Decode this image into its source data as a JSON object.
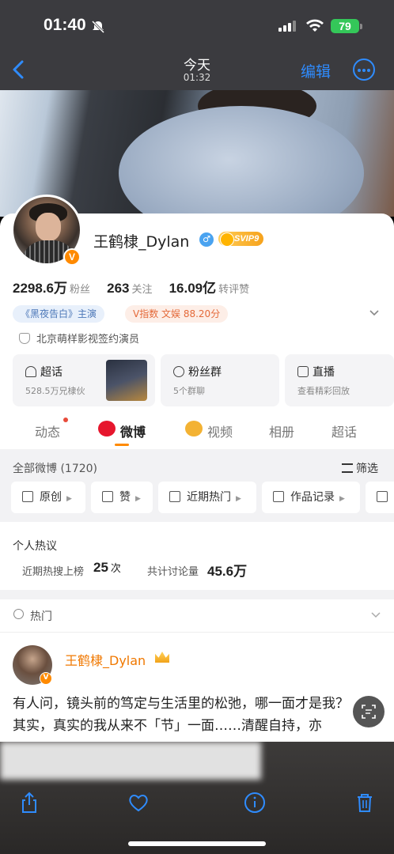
{
  "status_bar": {
    "time": "01:40",
    "battery": "79"
  },
  "nav": {
    "title": "今天",
    "subtitle": "01:32",
    "edit_label": "编辑"
  },
  "profile": {
    "name": "王鹤棣_Dylan",
    "svip_label": "SVIP9",
    "stats": [
      {
        "value": "2298.6万",
        "label": "粉丝"
      },
      {
        "value": "263",
        "label": "关注"
      },
      {
        "value": "16.09亿",
        "label": "转评赞"
      }
    ],
    "tags": [
      "《黑夜告白》主演",
      "V指数 文娱 88.20分"
    ],
    "agency": "北京萌样影视签约演员",
    "tiles": [
      {
        "title": "超话",
        "sub": "528.5万兄棣伙"
      },
      {
        "title": "粉丝群",
        "sub": "5个群聊"
      },
      {
        "title": "直播",
        "sub": "查看精彩回放"
      }
    ]
  },
  "tabs": [
    "动态",
    "微博",
    "视频",
    "相册",
    "超话"
  ],
  "feed": {
    "all_posts": "全部微博 (1720)",
    "filter_label": "筛选",
    "chips": [
      "原创",
      "赞",
      "近期热门",
      "作品记录"
    ],
    "hot_title": "个人热议",
    "hot_search_label": "近期热搜上榜",
    "hot_search_value": "25",
    "hot_search_unit": "次",
    "discussion_label": "共计讨论量",
    "discussion_value": "45.6万",
    "section_title": "热门"
  },
  "post": {
    "author": "王鹤棣_Dylan",
    "text": "有人问，镜头前的笃定与生活里的松弛，哪一面才是我？其实，真实的我从来不「节」一面……清醒自持，亦"
  },
  "colors": {
    "accent": "#ff8a00",
    "link_blue": "#2f8cff",
    "name_orange": "#f07800"
  }
}
